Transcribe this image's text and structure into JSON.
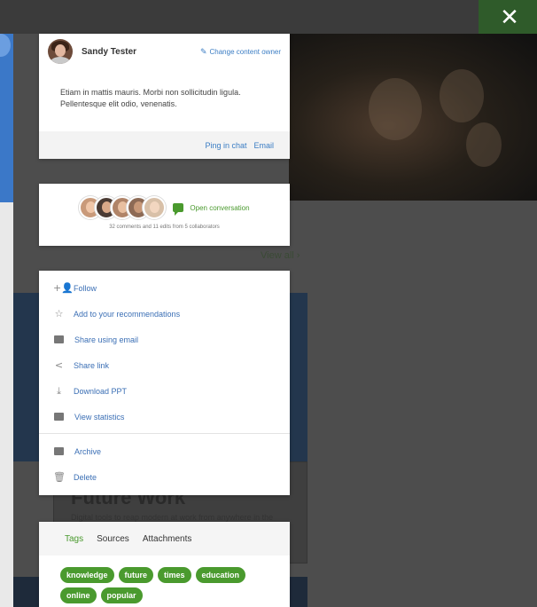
{
  "close": {
    "icon": "close-icon",
    "glyph": "✕"
  },
  "background": {
    "view_all": "View all ›",
    "future_title": "Future Work",
    "future_desc": "Digital tools to reap modern at work from anywhere in the"
  },
  "owner": {
    "name": "Sandy Tester",
    "change_label": "Change content owner",
    "message": "Etiam in mattis mauris. Morbi non sollicitudin ligula. Pellentesque elit odio, venenatis.",
    "ping_label": "Ping in chat",
    "email_label": "Email"
  },
  "collaborators": {
    "open_label": "Open conversation",
    "summary": "32 comments and 11 edits from 5 collaborators",
    "avatar_colors": [
      "#c99a7a",
      "#4a3a33",
      "#b08468",
      "#8d6a55",
      "#d8c0a8"
    ]
  },
  "menu": {
    "items": [
      {
        "label": "Follow",
        "icon": "add-person-icon"
      },
      {
        "label": "Add to your recommendations",
        "icon": "star-icon"
      },
      {
        "label": "Share using email",
        "icon": "envelope-icon"
      },
      {
        "label": "Share link",
        "icon": "share-icon"
      },
      {
        "label": "Download PPT",
        "icon": "download-icon"
      },
      {
        "label": "View statistics",
        "icon": "bar-chart-icon"
      }
    ],
    "secondary": [
      {
        "label": "Archive",
        "icon": "archive-icon"
      },
      {
        "label": "Delete",
        "icon": "trash-icon"
      }
    ]
  },
  "tags_card": {
    "tabs": [
      "Tags",
      "Sources",
      "Attachments"
    ],
    "active_tab": "Tags",
    "tags": [
      "knowledge",
      "future",
      "times",
      "education",
      "online",
      "popular"
    ]
  },
  "colors": {
    "accent_green": "#4a9a2e",
    "link_blue": "#3b7dc4"
  }
}
